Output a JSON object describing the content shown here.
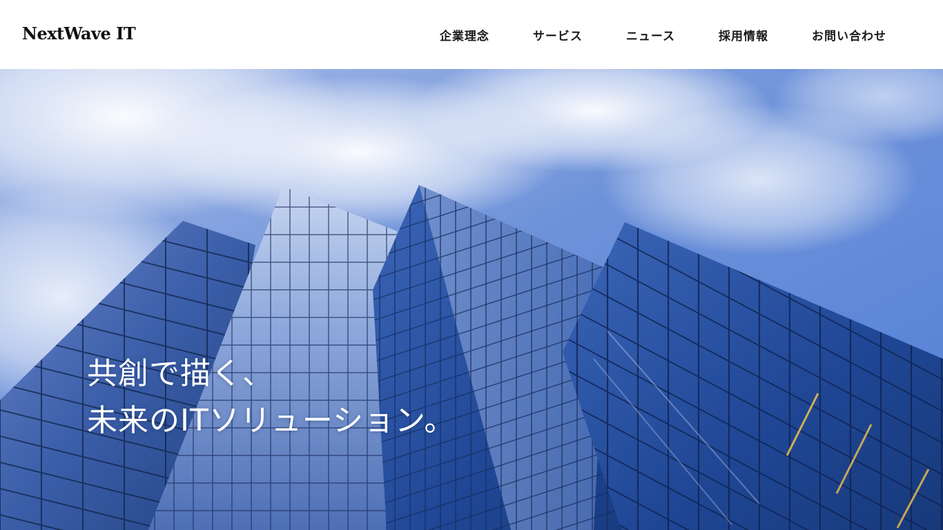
{
  "header": {
    "logo": "NextWave IT",
    "nav": [
      {
        "label": "企業理念"
      },
      {
        "label": "サービス"
      },
      {
        "label": "ニュース"
      },
      {
        "label": "採用情報"
      },
      {
        "label": "お問い合わせ"
      }
    ]
  },
  "hero": {
    "headline_line1": "共創で描く、",
    "headline_line2": "未来のITソリューション。",
    "image": "glass-skyscrapers-against-blue-sky"
  },
  "colors": {
    "header_bg": "#ffffff",
    "text_dark": "#111111",
    "sky": "#6b8fd8",
    "glass": "#2d4f9a",
    "hero_text": "#ffffff"
  }
}
